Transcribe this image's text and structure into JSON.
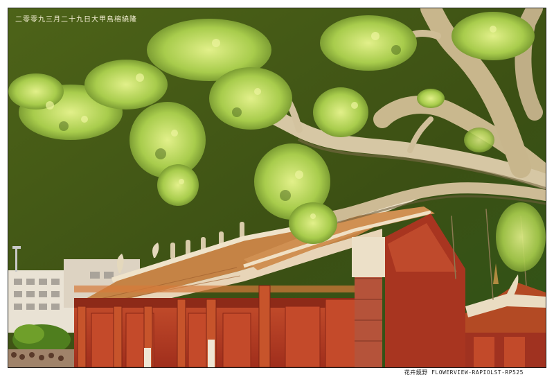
{
  "captions": {
    "top_left": "二零零九三月二十九日大甲鳥榕繞隆",
    "bottom_right": "花卉鏡野  FLOWERVIEW-RAPIOLST-RP525"
  },
  "colors": {
    "sky": "#3e5214",
    "sky_light": "#57701c",
    "foliage": "#b6d85a",
    "foliage_dark": "#5d7b1f",
    "branch": "#d6c7a4",
    "roof_tile": "#c98a4a",
    "roof_ridge": "#f0ddc4",
    "wall_red": "#b33a22",
    "column": "#c7542b",
    "brick": "#b5533a"
  },
  "icons": {
    "photo": "temple-banyan-photo"
  }
}
